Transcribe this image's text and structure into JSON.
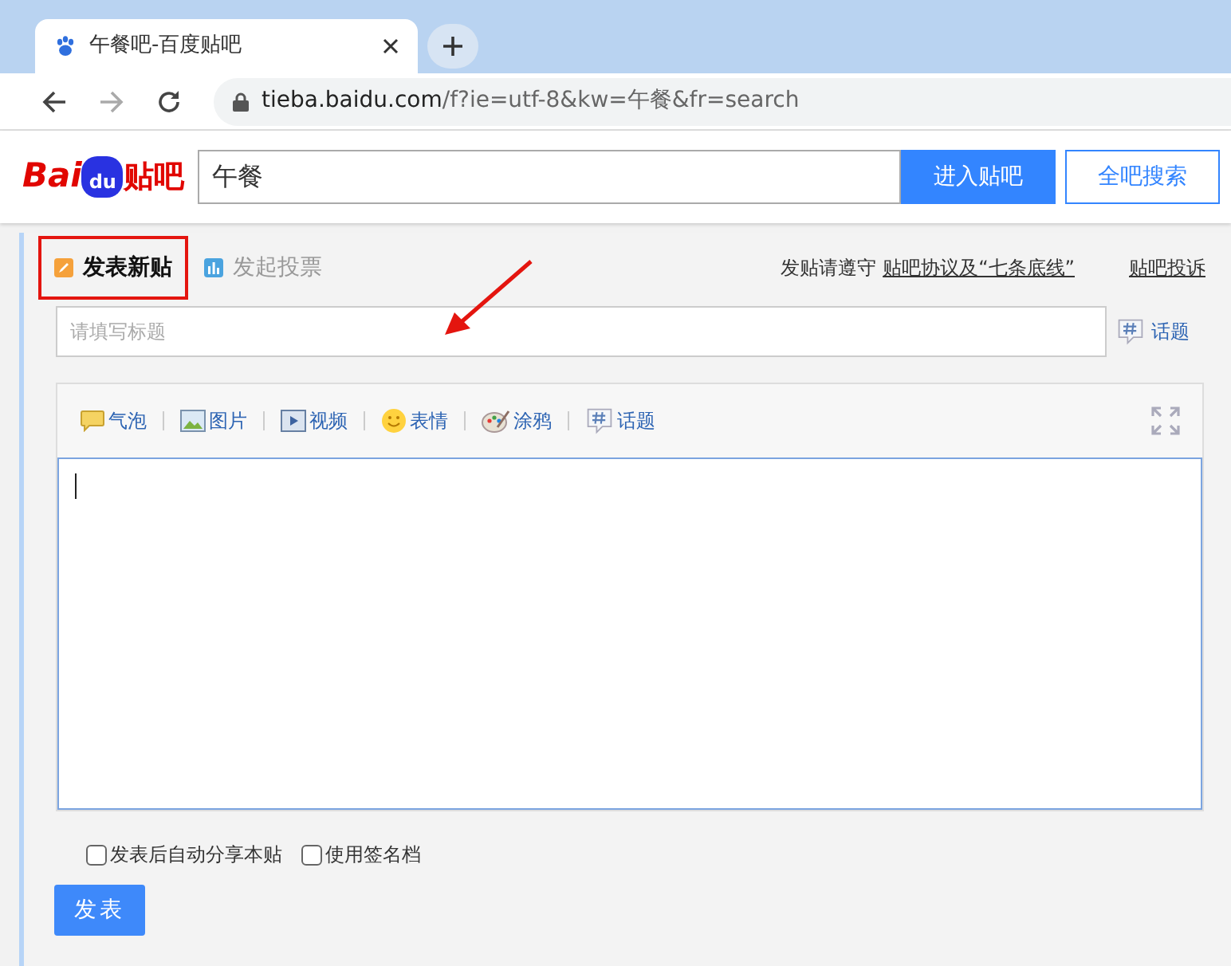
{
  "browser": {
    "tab": {
      "title": "午餐吧-百度贴吧"
    },
    "address": {
      "host": "tieba.baidu.com",
      "path": "/f?ie=utf-8&kw=午餐&fr=search"
    }
  },
  "header": {
    "logo": [
      "Bai",
      "du",
      "贴吧"
    ],
    "search": {
      "value": "午餐"
    },
    "buttons": [
      {
        "label": "进入贴吧",
        "kind": "primary"
      },
      {
        "label": "全吧搜索",
        "kind": "outline"
      }
    ]
  },
  "post_tabs": [
    {
      "label": "发表新贴",
      "selected": true,
      "kind": "pencil"
    },
    {
      "label": "发起投票",
      "selected": false,
      "kind": "chart"
    }
  ],
  "notice": {
    "text": "发贴请遵守",
    "link": "贴吧协议及“七条底线”",
    "report": "贴吧投诉"
  },
  "title_field": {
    "placeholder": "请填写标题",
    "topic": "话题"
  },
  "toolbar": [
    {
      "label": "气泡",
      "kind": "bubble"
    },
    {
      "label": "图片",
      "kind": "image"
    },
    {
      "label": "视频",
      "kind": "video"
    },
    {
      "label": "表情",
      "kind": "smiley"
    },
    {
      "label": "涂鸦",
      "kind": "palette"
    },
    {
      "label": "话题",
      "kind": "hash"
    }
  ],
  "options": [
    {
      "label": "发表后自动分享本贴",
      "checked": false
    },
    {
      "label": "使用签名档",
      "checked": false
    }
  ],
  "submit": "发表"
}
